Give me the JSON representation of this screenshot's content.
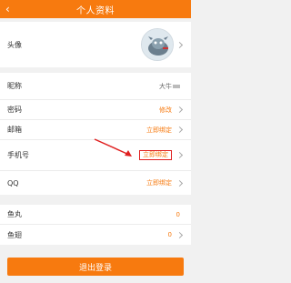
{
  "header": {
    "title": "个人资料",
    "back_icon": "chevron-left-icon"
  },
  "avatar_section": {
    "label": "头像",
    "icon": "avatar-image"
  },
  "account_rows": [
    {
      "label": "昵称",
      "value": "大牛"
    },
    {
      "label": "密码",
      "value": "修改"
    },
    {
      "label": "邮箱",
      "value": "立即绑定"
    },
    {
      "label": "手机号",
      "value": "立即绑定"
    },
    {
      "label": "QQ",
      "value": "立即绑定"
    }
  ],
  "asset_rows": [
    {
      "label": "鱼丸",
      "value": "0"
    },
    {
      "label": "鱼翅",
      "value": "0"
    }
  ],
  "logout_label": "退出登录",
  "colors": {
    "accent": "#f77a0f",
    "highlight_box": "#e02020"
  }
}
